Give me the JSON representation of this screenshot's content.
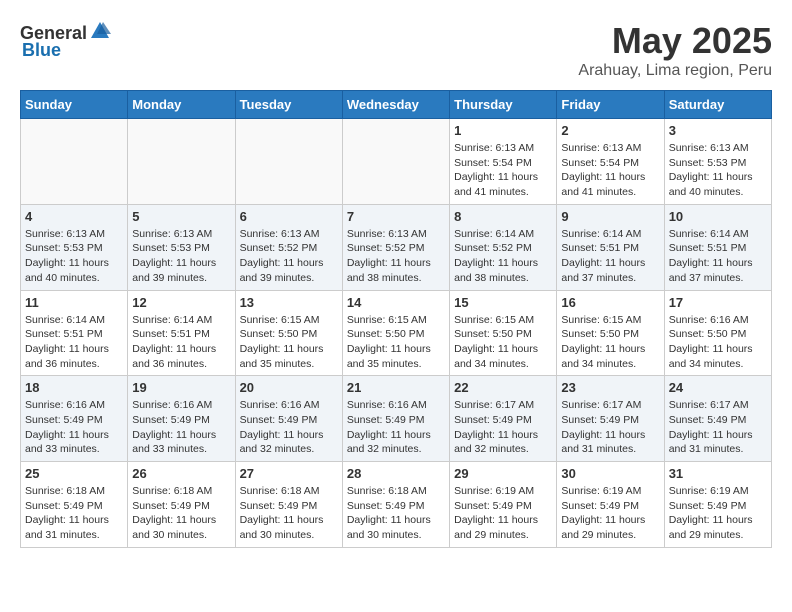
{
  "logo": {
    "text_general": "General",
    "text_blue": "Blue",
    "icon_alt": "GeneralBlue logo"
  },
  "title": "May 2025",
  "subtitle": "Arahuay, Lima region, Peru",
  "weekdays": [
    "Sunday",
    "Monday",
    "Tuesday",
    "Wednesday",
    "Thursday",
    "Friday",
    "Saturday"
  ],
  "weeks": [
    [
      {
        "day": "",
        "info": ""
      },
      {
        "day": "",
        "info": ""
      },
      {
        "day": "",
        "info": ""
      },
      {
        "day": "",
        "info": ""
      },
      {
        "day": "1",
        "info": "Sunrise: 6:13 AM\nSunset: 5:54 PM\nDaylight: 11 hours and 41 minutes."
      },
      {
        "day": "2",
        "info": "Sunrise: 6:13 AM\nSunset: 5:54 PM\nDaylight: 11 hours and 41 minutes."
      },
      {
        "day": "3",
        "info": "Sunrise: 6:13 AM\nSunset: 5:53 PM\nDaylight: 11 hours and 40 minutes."
      }
    ],
    [
      {
        "day": "4",
        "info": "Sunrise: 6:13 AM\nSunset: 5:53 PM\nDaylight: 11 hours and 40 minutes."
      },
      {
        "day": "5",
        "info": "Sunrise: 6:13 AM\nSunset: 5:53 PM\nDaylight: 11 hours and 39 minutes."
      },
      {
        "day": "6",
        "info": "Sunrise: 6:13 AM\nSunset: 5:52 PM\nDaylight: 11 hours and 39 minutes."
      },
      {
        "day": "7",
        "info": "Sunrise: 6:13 AM\nSunset: 5:52 PM\nDaylight: 11 hours and 38 minutes."
      },
      {
        "day": "8",
        "info": "Sunrise: 6:14 AM\nSunset: 5:52 PM\nDaylight: 11 hours and 38 minutes."
      },
      {
        "day": "9",
        "info": "Sunrise: 6:14 AM\nSunset: 5:51 PM\nDaylight: 11 hours and 37 minutes."
      },
      {
        "day": "10",
        "info": "Sunrise: 6:14 AM\nSunset: 5:51 PM\nDaylight: 11 hours and 37 minutes."
      }
    ],
    [
      {
        "day": "11",
        "info": "Sunrise: 6:14 AM\nSunset: 5:51 PM\nDaylight: 11 hours and 36 minutes."
      },
      {
        "day": "12",
        "info": "Sunrise: 6:14 AM\nSunset: 5:51 PM\nDaylight: 11 hours and 36 minutes."
      },
      {
        "day": "13",
        "info": "Sunrise: 6:15 AM\nSunset: 5:50 PM\nDaylight: 11 hours and 35 minutes."
      },
      {
        "day": "14",
        "info": "Sunrise: 6:15 AM\nSunset: 5:50 PM\nDaylight: 11 hours and 35 minutes."
      },
      {
        "day": "15",
        "info": "Sunrise: 6:15 AM\nSunset: 5:50 PM\nDaylight: 11 hours and 34 minutes."
      },
      {
        "day": "16",
        "info": "Sunrise: 6:15 AM\nSunset: 5:50 PM\nDaylight: 11 hours and 34 minutes."
      },
      {
        "day": "17",
        "info": "Sunrise: 6:16 AM\nSunset: 5:50 PM\nDaylight: 11 hours and 34 minutes."
      }
    ],
    [
      {
        "day": "18",
        "info": "Sunrise: 6:16 AM\nSunset: 5:49 PM\nDaylight: 11 hours and 33 minutes."
      },
      {
        "day": "19",
        "info": "Sunrise: 6:16 AM\nSunset: 5:49 PM\nDaylight: 11 hours and 33 minutes."
      },
      {
        "day": "20",
        "info": "Sunrise: 6:16 AM\nSunset: 5:49 PM\nDaylight: 11 hours and 32 minutes."
      },
      {
        "day": "21",
        "info": "Sunrise: 6:16 AM\nSunset: 5:49 PM\nDaylight: 11 hours and 32 minutes."
      },
      {
        "day": "22",
        "info": "Sunrise: 6:17 AM\nSunset: 5:49 PM\nDaylight: 11 hours and 32 minutes."
      },
      {
        "day": "23",
        "info": "Sunrise: 6:17 AM\nSunset: 5:49 PM\nDaylight: 11 hours and 31 minutes."
      },
      {
        "day": "24",
        "info": "Sunrise: 6:17 AM\nSunset: 5:49 PM\nDaylight: 11 hours and 31 minutes."
      }
    ],
    [
      {
        "day": "25",
        "info": "Sunrise: 6:18 AM\nSunset: 5:49 PM\nDaylight: 11 hours and 31 minutes."
      },
      {
        "day": "26",
        "info": "Sunrise: 6:18 AM\nSunset: 5:49 PM\nDaylight: 11 hours and 30 minutes."
      },
      {
        "day": "27",
        "info": "Sunrise: 6:18 AM\nSunset: 5:49 PM\nDaylight: 11 hours and 30 minutes."
      },
      {
        "day": "28",
        "info": "Sunrise: 6:18 AM\nSunset: 5:49 PM\nDaylight: 11 hours and 30 minutes."
      },
      {
        "day": "29",
        "info": "Sunrise: 6:19 AM\nSunset: 5:49 PM\nDaylight: 11 hours and 29 minutes."
      },
      {
        "day": "30",
        "info": "Sunrise: 6:19 AM\nSunset: 5:49 PM\nDaylight: 11 hours and 29 minutes."
      },
      {
        "day": "31",
        "info": "Sunrise: 6:19 AM\nSunset: 5:49 PM\nDaylight: 11 hours and 29 minutes."
      }
    ]
  ]
}
